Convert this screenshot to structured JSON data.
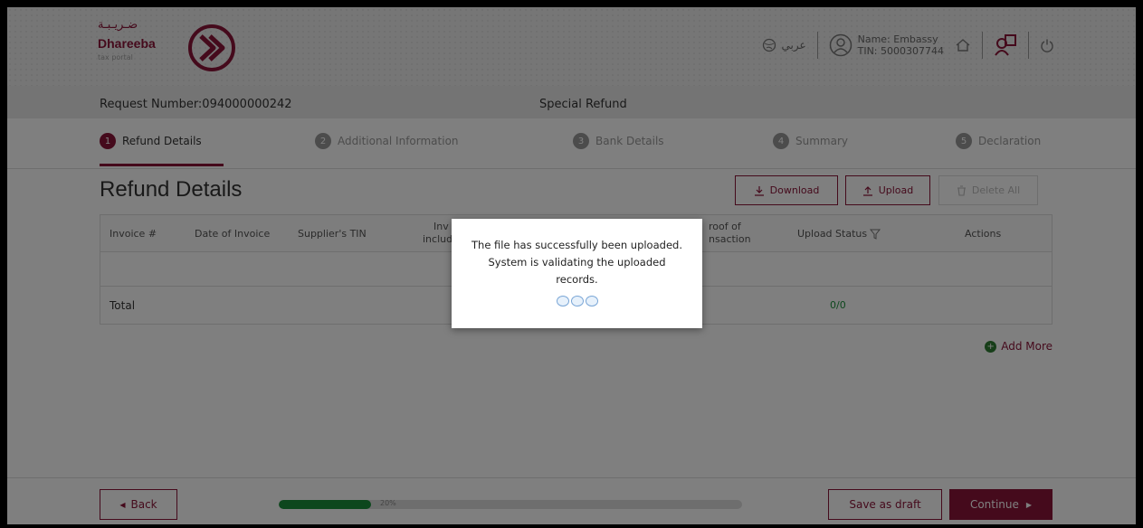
{
  "header": {
    "logo_arabic": "ضـريـبـة",
    "logo_english": "Dhareeba",
    "logo_sub": "tax portal",
    "language": "عربي",
    "user_name": "Name: Embassy",
    "user_tin": "TIN: 5000307744"
  },
  "request": {
    "number": "Request Number:094000000242",
    "type": "Special Refund"
  },
  "steps": [
    {
      "num": "1",
      "label": "Refund Details"
    },
    {
      "num": "2",
      "label": "Additional Information"
    },
    {
      "num": "3",
      "label": "Bank Details"
    },
    {
      "num": "4",
      "label": "Summary"
    },
    {
      "num": "5",
      "label": "Declaration"
    }
  ],
  "content": {
    "title": "Refund Details",
    "download_label": "Download",
    "upload_label": "Upload",
    "delete_all_label": "Delete All"
  },
  "table": {
    "columns": [
      "Invoice #",
      "Date of Invoice",
      "Supplier's TIN",
      "Inv",
      "includ",
      "roof of",
      "nsaction",
      "Upload Status",
      "Actions"
    ],
    "total_label": "Total",
    "total_count": "0/0"
  },
  "add_more_label": "Add More",
  "footer": {
    "back_label": "Back",
    "progress_value": 0.2,
    "progress_text": "20%",
    "save_draft_label": "Save as draft",
    "continue_label": "Continue"
  },
  "modal": {
    "message": "The file has successfully been uploaded. System is validating the uploaded records."
  },
  "colors": {
    "brand": "#8a1538",
    "success": "#1b8f3a"
  }
}
